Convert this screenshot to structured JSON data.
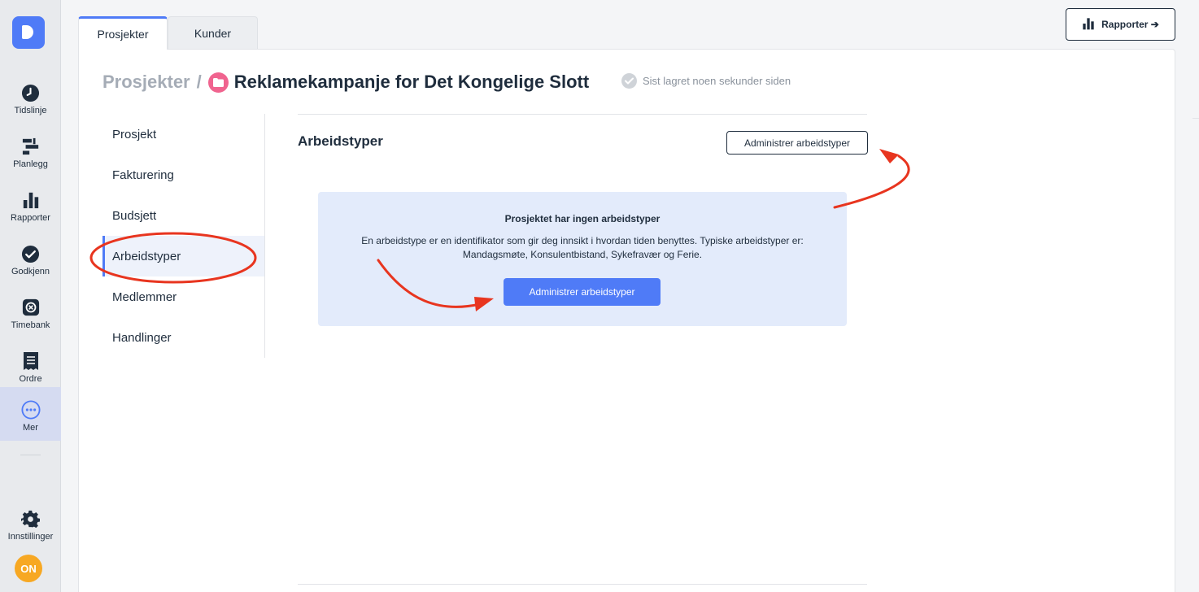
{
  "sidebar": {
    "items": [
      {
        "label": "Tidslinje",
        "icon": "clock-icon"
      },
      {
        "label": "Planlegg",
        "icon": "plan-icon"
      },
      {
        "label": "Rapporter",
        "icon": "bar-chart-icon"
      },
      {
        "label": "Godkjenn",
        "icon": "check-circle-icon"
      },
      {
        "label": "Timebank",
        "icon": "timebank-icon"
      },
      {
        "label": "Ordre",
        "icon": "receipt-icon"
      },
      {
        "label": "Mer",
        "icon": "more-icon"
      }
    ],
    "settings_label": "Innstillinger",
    "avatar_initials": "ON"
  },
  "tabs": [
    "Prosjekter",
    "Kunder"
  ],
  "reports_button": "Rapporter ➔",
  "breadcrumb": {
    "root": "Prosjekter",
    "separator": "/",
    "title": "Reklamekampanje for Det Kongelige Slott"
  },
  "saved_status": "Sist lagret noen sekunder siden",
  "menu": [
    "Prosjekt",
    "Fakturering",
    "Budsjett",
    "Arbeidstyper",
    "Medlemmer",
    "Handlinger"
  ],
  "section": {
    "title": "Arbeidstyper",
    "manage_button": "Administrer arbeidstyper"
  },
  "empty_state": {
    "title": "Prosjektet har ingen arbeidstyper",
    "text": "En arbeidstype er en identifikator som gir deg innsikt i hvordan tiden benyttes. Typiske arbeidstyper er: Mandagsmøte, Konsulentbistand, Sykefravær og Ferie.",
    "button": "Administrer arbeidstyper"
  },
  "colors": {
    "accent": "#4f7bf7",
    "project_dot": "#f0648f",
    "annotation": "#e8351f",
    "avatar": "#f7a823"
  }
}
